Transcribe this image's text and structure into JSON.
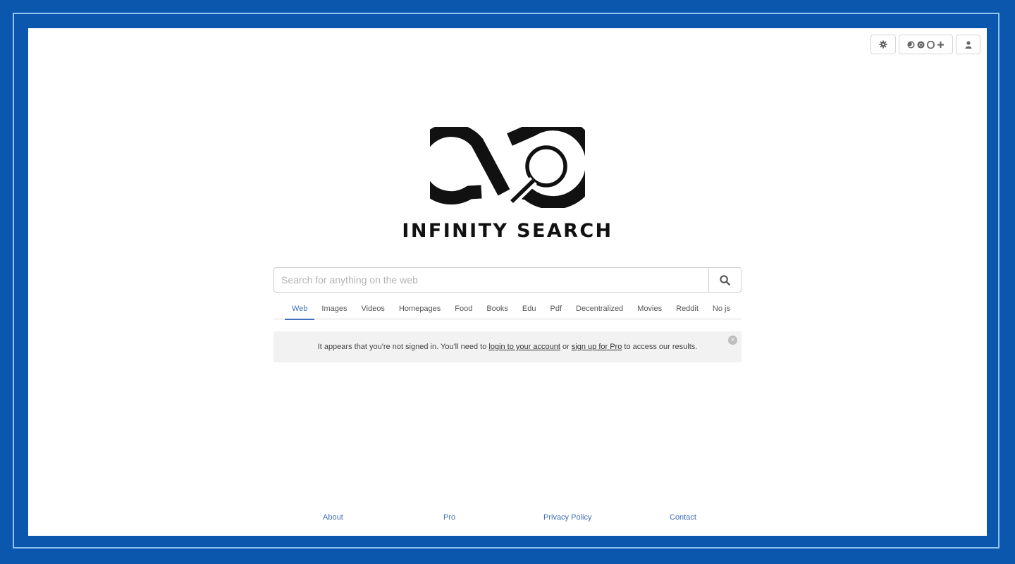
{
  "header": {
    "settings_icon": "gear-icon",
    "browser_icons": [
      "firefox-icon",
      "chrome-icon",
      "opera-icon",
      "plus-icon"
    ],
    "account_icon": "user-icon"
  },
  "brand": {
    "name": "INFINITY SEARCH"
  },
  "search": {
    "placeholder": "Search for anything on the web",
    "value": ""
  },
  "tabs": [
    {
      "label": "Web",
      "active": true
    },
    {
      "label": "Images"
    },
    {
      "label": "Videos"
    },
    {
      "label": "Homepages"
    },
    {
      "label": "Food"
    },
    {
      "label": "Books"
    },
    {
      "label": "Edu"
    },
    {
      "label": "Pdf"
    },
    {
      "label": "Decentralized"
    },
    {
      "label": "Movies"
    },
    {
      "label": "Reddit"
    },
    {
      "label": "No js"
    }
  ],
  "notice": {
    "text_before": "It appears that you're not signed in. You'll need to ",
    "login_link": "login to your account",
    "text_mid": " or ",
    "signup_link": "sign up for Pro",
    "text_after": " to access our results.",
    "close_symbol": "×"
  },
  "footer": {
    "about": "About",
    "pro": "Pro",
    "privacy": "Privacy Policy",
    "contact": "Contact"
  },
  "colors": {
    "outer_background": "#0b57ae",
    "frame_line": "#8ec3f2",
    "link_blue": "#3f6fb8",
    "notice_background": "#f2f2f2"
  }
}
